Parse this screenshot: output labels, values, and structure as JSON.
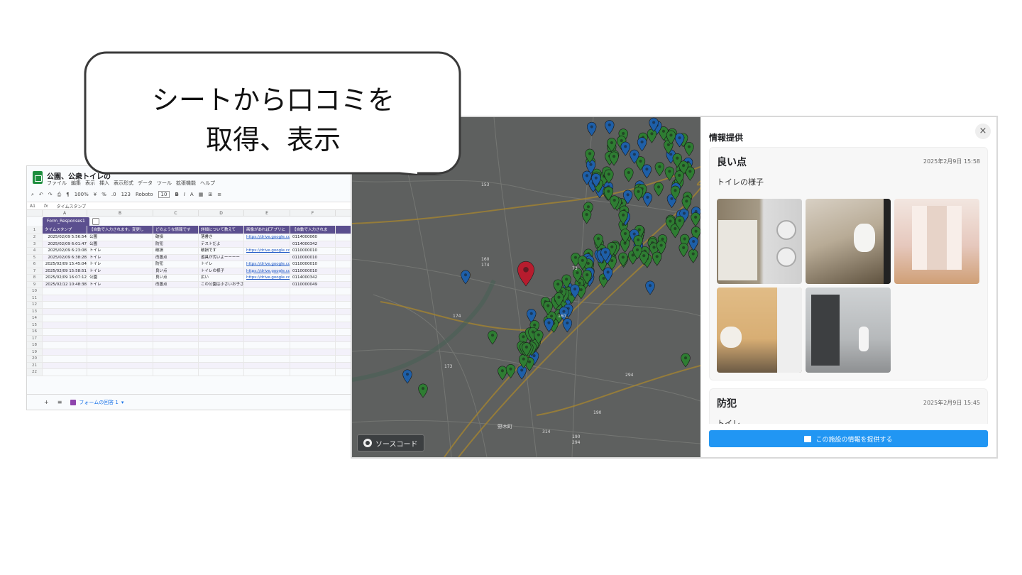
{
  "bubble": {
    "line1": "シートから口コミを",
    "line2": "取得、表示"
  },
  "sheet": {
    "title": "公園、公衆トイレの",
    "menu": [
      "ファイル",
      "編集",
      "表示",
      "挿入",
      "表示形式",
      "データ",
      "ツール",
      "拡張機能",
      "ヘルプ"
    ],
    "toolbar": [
      "100%",
      "¥",
      "%",
      ".0",
      "123",
      "Roboto",
      "10",
      "B",
      "I",
      "A"
    ],
    "cell_ref": "A1",
    "formula": "タイムスタンプ",
    "fx_label": "fx",
    "col_letters": [
      "A",
      "B",
      "C",
      "D",
      "E",
      "F"
    ],
    "table_name": "Form_Responses1",
    "headers": [
      "タイムスタンプ",
      "【自動で入力されます。変更し",
      "どのような情報です",
      "詳細について教えて",
      "画像があればアプリに",
      "【自動で入力されま"
    ],
    "rows": [
      [
        "2025/02/09 5:56:54",
        "公園",
        "破損",
        "落書き",
        "https://drive.google.com",
        "0114000060"
      ],
      [
        "2025/02/09 6:01:47",
        "公園",
        "防犯",
        "テストだよ",
        "",
        "0114000342"
      ],
      [
        "2025/02/09 6:23:08",
        "トイレ",
        "破損",
        "破損です",
        "https://drive.google.com",
        "0110000010"
      ],
      [
        "2025/02/09 6:38:28",
        "トイレ",
        "改善点",
        "遊具が汚いよーーーー",
        "",
        "0110000010"
      ],
      [
        "2025/02/09 15:45:04",
        "トイレ",
        "防犯",
        "トイレ",
        "https://drive.google.com",
        "0110000010"
      ],
      [
        "2025/02/09 15:58:51",
        "トイレ",
        "良い点",
        "トイレの様子",
        "https://drive.google.com",
        "0110000010"
      ],
      [
        "2025/02/09 16:07:12",
        "公園",
        "良い点",
        "広い",
        "https://drive.google.com",
        "0114000342"
      ],
      [
        "2025/02/12 10:48:38",
        "トイレ",
        "改善点",
        "この公園は小さいお子さ",
        "",
        "0110000049"
      ]
    ],
    "row_numbers": [
      "1",
      "2",
      "3",
      "4",
      "5",
      "6",
      "7",
      "8",
      "9",
      "10",
      "11",
      "12",
      "13",
      "14",
      "15",
      "16",
      "17",
      "18",
      "19",
      "20",
      "21",
      "22"
    ],
    "add_sheet": "+",
    "sheet_list": "≡",
    "tab_label": "フォームの回答 1"
  },
  "map": {
    "source_button": "ソースコード",
    "labels": [
      "153",
      "160",
      "174",
      "174",
      "160",
      "173",
      "294",
      "190",
      "314",
      "野木町",
      "190",
      "294",
      "73"
    ]
  },
  "panel": {
    "title": "情報提供",
    "close": "×",
    "cards": [
      {
        "type": "良い点",
        "date": "2025年2月9日 15:58",
        "text": "トイレの様子"
      },
      {
        "type": "防犯",
        "date": "2025年2月9日 15:45",
        "text": "トイレ"
      }
    ],
    "cta": "この施設の情報を提供する"
  },
  "colors": {
    "header_purple": "#5b4f8f",
    "cta_blue": "#2196f3",
    "pin_green": "#2e7d32",
    "pin_blue": "#1e5fa8",
    "pin_red": "#b71c2e"
  }
}
